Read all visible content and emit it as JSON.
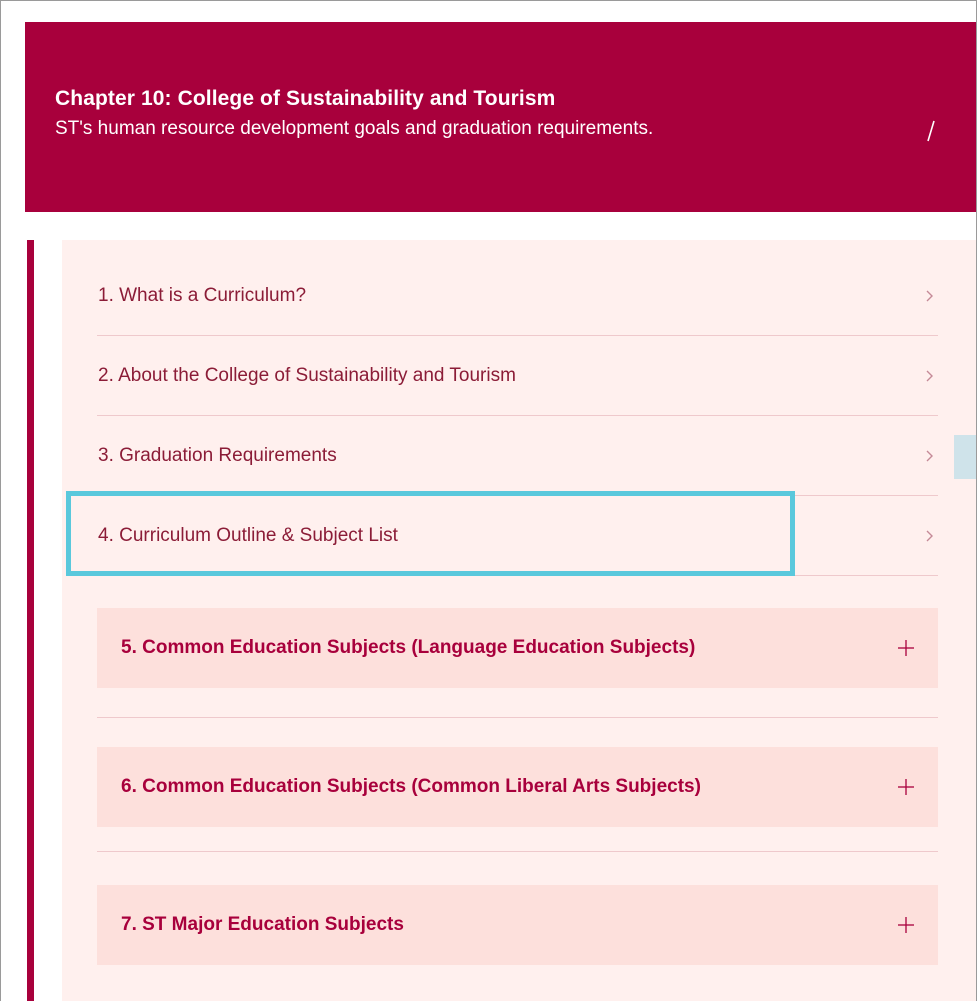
{
  "chapter": {
    "title": "Chapter 10: College of Sustainability and Tourism",
    "subtitle": "ST's human resource development goals and graduation requirements."
  },
  "items": [
    {
      "label": "1. What is a Curriculum?"
    },
    {
      "label": "2. About the College of Sustainability and Tourism"
    },
    {
      "label": "3. Graduation Requirements"
    },
    {
      "label": "4. Curriculum Outline & Subject List"
    }
  ],
  "sections": [
    {
      "label": "5. Common Education Subjects (Language Education Subjects)"
    },
    {
      "label": "6. Common Education Subjects (Common Liberal Arts Subjects)"
    },
    {
      "label": "7. ST Major Education Subjects"
    }
  ],
  "colors": {
    "header_bg": "#a8003c",
    "panel_bg": "#fff0ee",
    "section_bg": "#fde0dc",
    "item_text": "#8b1c37",
    "highlight": "#5ac8dc"
  },
  "icons": {
    "item_indicator": "chevron-right-icon",
    "section_indicator": "plus-icon",
    "chapter_indicator": "slash-icon"
  }
}
